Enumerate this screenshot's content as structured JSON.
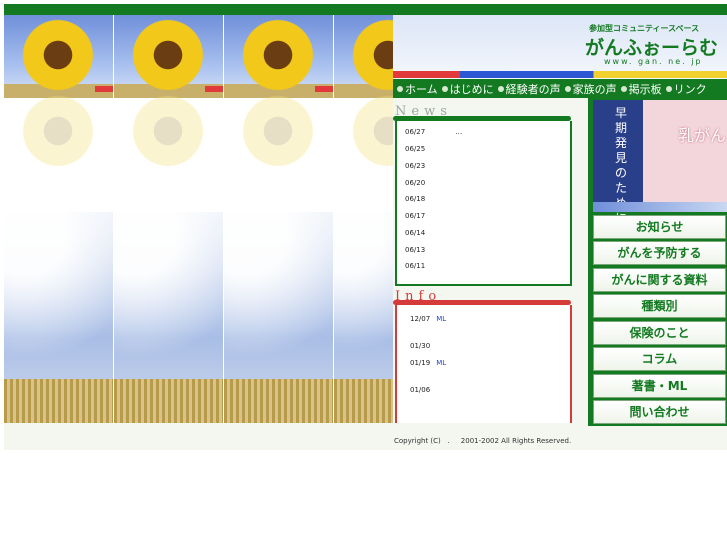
{
  "header": {
    "subtitle": "参加型コミュニティースペース",
    "logo": "がんふぉーらむ",
    "url": "www. gan. ne. jp"
  },
  "nav": [
    {
      "label": "ホーム"
    },
    {
      "label": "はじめに"
    },
    {
      "label": "経験者の声"
    },
    {
      "label": "家族の声"
    },
    {
      "label": "掲示板"
    },
    {
      "label": "リンク"
    }
  ],
  "news": {
    "title": "News",
    "items": [
      {
        "date": "06/27",
        "text": "…"
      },
      {
        "date": "06/25",
        "text": ""
      },
      {
        "date": "06/23",
        "text": ""
      },
      {
        "date": "06/20",
        "text": ""
      },
      {
        "date": "06/18",
        "text": ""
      },
      {
        "date": "06/17",
        "text": ""
      },
      {
        "date": "06/14",
        "text": ""
      },
      {
        "date": "06/13",
        "text": ""
      },
      {
        "date": "06/11",
        "text": ""
      }
    ]
  },
  "info": {
    "title": "Info",
    "items": [
      {
        "date": "12/07",
        "link": "ML"
      },
      {
        "date": "01/30",
        "link": ""
      },
      {
        "date": "01/19",
        "link": "ML"
      },
      {
        "date": "01/06",
        "link": ""
      }
    ]
  },
  "banner": {
    "vertical_text": "早期発見のために",
    "title": "乳がん"
  },
  "menu": [
    {
      "label": "お知らせ"
    },
    {
      "label": "がんを予防する"
    },
    {
      "label": "がんに関する資料"
    },
    {
      "label": "種類別"
    },
    {
      "label": "保険のこと"
    },
    {
      "label": "コラム"
    },
    {
      "label": "著書・ML"
    },
    {
      "label": "問い合わせ"
    }
  ],
  "footer": {
    "copyright": "Copyright (C)   .     2001-2002 All Rights Reserved."
  },
  "colors": {
    "brand_green": "#137a21",
    "link_blue": "#2244cc",
    "news_accent": "#137a21",
    "info_accent": "#d63b3b"
  }
}
